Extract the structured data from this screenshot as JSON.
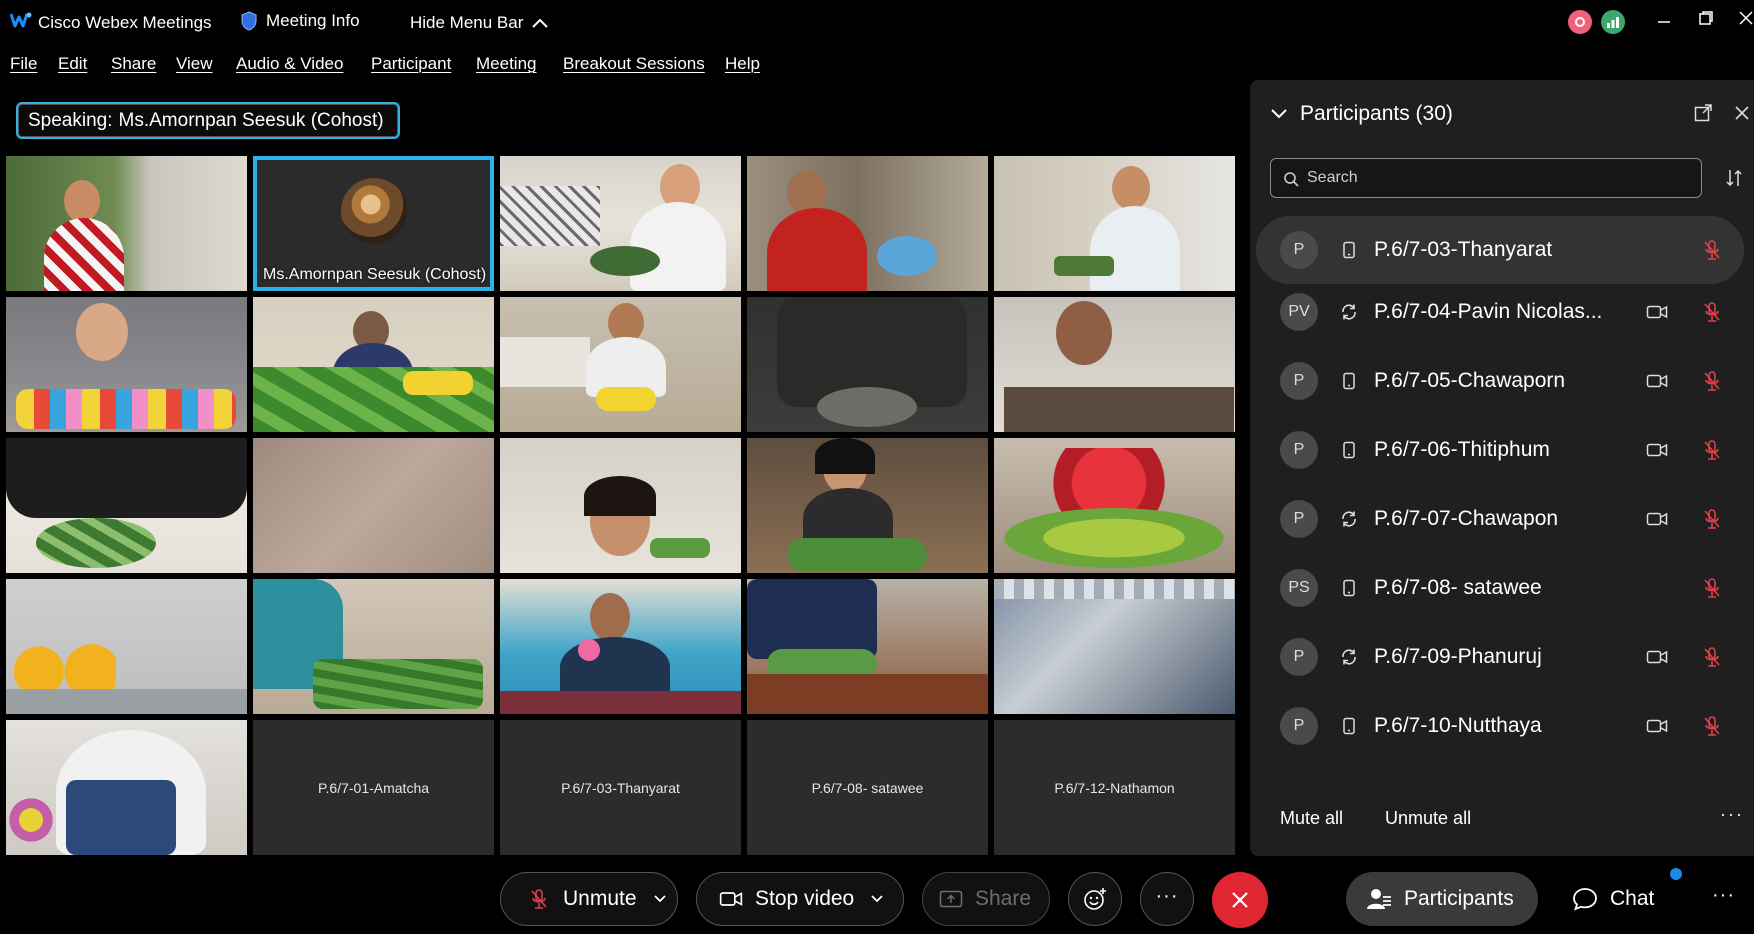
{
  "titlebar": {
    "app_name": "Cisco Webex Meetings",
    "meeting_info": "Meeting Info",
    "hide_menu": "Hide Menu Bar"
  },
  "menu": [
    "File",
    "Edit",
    "Share",
    "View",
    "Audio & Video",
    "Participant",
    "Meeting",
    "Breakout Sessions",
    "Help"
  ],
  "speaking": {
    "prefix": "Speaking:",
    "name": "Ms.Amornpan Seesuk (Cohost)"
  },
  "grid": {
    "active_label": "Ms.Amornpan Seesuk  (Cohost)",
    "name_tiles": [
      "P.6/7-01-Amatcha",
      "P.6/7-03-Thanyarat",
      "P.6/7-08- satawee",
      "P.6/7-12-Nathamon"
    ]
  },
  "panel": {
    "title": "Participants (30)",
    "search_placeholder": "Search",
    "participants": [
      {
        "initials": "P",
        "device": "phone-icon",
        "name": "P.6/7-03-Thanyarat",
        "video": false
      },
      {
        "initials": "PV",
        "device": "sync-icon",
        "name": "P.6/7-04-Pavin Nicolas...",
        "video": true
      },
      {
        "initials": "P",
        "device": "phone-icon",
        "name": "P.6/7-05-Chawaporn",
        "video": true
      },
      {
        "initials": "P",
        "device": "phone-icon",
        "name": "P.6/7-06-Thitiphum",
        "video": true
      },
      {
        "initials": "P",
        "device": "sync-icon",
        "name": "P.6/7-07-Chawapon",
        "video": true
      },
      {
        "initials": "PS",
        "device": "phone-icon",
        "name": "P.6/7-08- satawee",
        "video": false
      },
      {
        "initials": "P",
        "device": "sync-icon",
        "name": "P.6/7-09-Phanuruj",
        "video": true
      },
      {
        "initials": "P",
        "device": "phone-icon",
        "name": "P.6/7-10-Nutthaya",
        "video": true
      }
    ],
    "mute_all": "Mute all",
    "unmute_all": "Unmute all"
  },
  "toolbar": {
    "unmute": "Unmute",
    "stop_video": "Stop video",
    "share": "Share",
    "participants": "Participants",
    "chat": "Chat"
  },
  "colors": {
    "accent": "#2ab3e8",
    "end_call": "#e02631",
    "mute_red": "#e0404a",
    "chat_badge": "#1e88e5"
  }
}
